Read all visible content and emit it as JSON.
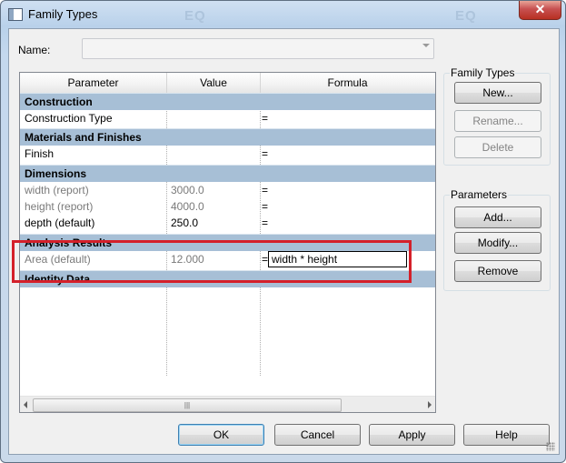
{
  "window": {
    "title": "Family Types",
    "close_label": "✕",
    "ghost_text": [
      "EQ",
      "EQ"
    ]
  },
  "name_field": {
    "label": "Name:",
    "value": ""
  },
  "grid": {
    "columns": [
      "Parameter",
      "Value",
      "Formula"
    ],
    "groups": [
      {
        "label": "Construction",
        "rows": [
          {
            "parameter": "Construction Type",
            "value": "",
            "formula": "=",
            "grayed": false
          }
        ]
      },
      {
        "label": "Materials and Finishes",
        "rows": [
          {
            "parameter": "Finish",
            "value": "",
            "formula": "=",
            "grayed": false
          }
        ]
      },
      {
        "label": "Dimensions",
        "rows": [
          {
            "parameter": "width (report)",
            "value": "3000.0",
            "formula": "=",
            "grayed": true
          },
          {
            "parameter": "height (report)",
            "value": "4000.0",
            "formula": "=",
            "grayed": true
          },
          {
            "parameter": "depth (default)",
            "value": "250.0",
            "formula": "=",
            "grayed": false
          }
        ]
      },
      {
        "label": "Analysis Results",
        "rows": [
          {
            "parameter": "Area (default)",
            "value": "12.000",
            "formula": "=",
            "formula_edit": "width * height",
            "grayed": true
          }
        ]
      },
      {
        "label": "Identity Data",
        "rows": []
      }
    ],
    "scroll_thumb": "|||"
  },
  "family_types_group": {
    "label": "Family Types",
    "new": "New...",
    "rename": "Rename...",
    "delete": "Delete"
  },
  "parameters_group": {
    "label": "Parameters",
    "add": "Add...",
    "modify": "Modify...",
    "remove": "Remove"
  },
  "footer": {
    "ok": "OK",
    "cancel": "Cancel",
    "apply": "Apply",
    "help": "Help"
  },
  "colors": {
    "group_header": "#a7bfd6",
    "highlight": "#d4202a",
    "title_bar": "#b9d1ea"
  }
}
